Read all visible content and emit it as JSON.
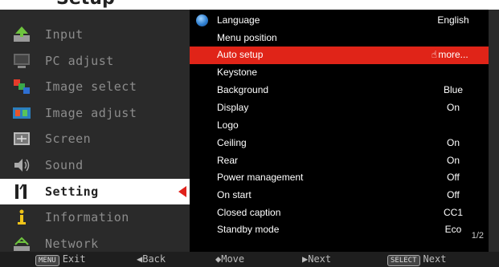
{
  "header": {
    "title": "Setup"
  },
  "left_menu": [
    {
      "label": "Input",
      "icon": "input-icon",
      "active": false
    },
    {
      "label": "PC adjust",
      "icon": "pc-adjust-icon",
      "active": false
    },
    {
      "label": "Image select",
      "icon": "image-select-icon",
      "active": false
    },
    {
      "label": "Image adjust",
      "icon": "image-adjust-icon",
      "active": false
    },
    {
      "label": "Screen",
      "icon": "screen-icon",
      "active": false
    },
    {
      "label": "Sound",
      "icon": "sound-icon",
      "active": false
    },
    {
      "label": "Setting",
      "icon": "setting-icon",
      "active": true
    },
    {
      "label": "Information",
      "icon": "information-icon",
      "active": false
    },
    {
      "label": "Network",
      "icon": "network-icon",
      "active": false
    }
  ],
  "settings": [
    {
      "label": "Language",
      "value": "English"
    },
    {
      "label": "Menu position",
      "value": ""
    },
    {
      "label": "Auto setup",
      "value": "more..."
    },
    {
      "label": "Keystone",
      "value": ""
    },
    {
      "label": "Background",
      "value": "Blue"
    },
    {
      "label": "Display",
      "value": "On"
    },
    {
      "label": "Logo",
      "value": ""
    },
    {
      "label": "Ceiling",
      "value": "On"
    },
    {
      "label": "Rear",
      "value": "On"
    },
    {
      "label": "Power management",
      "value": "Off"
    },
    {
      "label": "On start",
      "value": "Off"
    },
    {
      "label": "Closed caption",
      "value": "CC1"
    },
    {
      "label": "Standby mode",
      "value": "Eco"
    }
  ],
  "pager": "1/2",
  "footer": {
    "exit_key": "MENU",
    "exit": "Exit",
    "back": "◀Back",
    "move": "◆Move",
    "next": "▶Next",
    "select_key": "SELECT",
    "select_next": "Next"
  },
  "colors": {
    "accent": "#e02418",
    "panel": "#2a2a2a",
    "list_bg": "#000000"
  }
}
